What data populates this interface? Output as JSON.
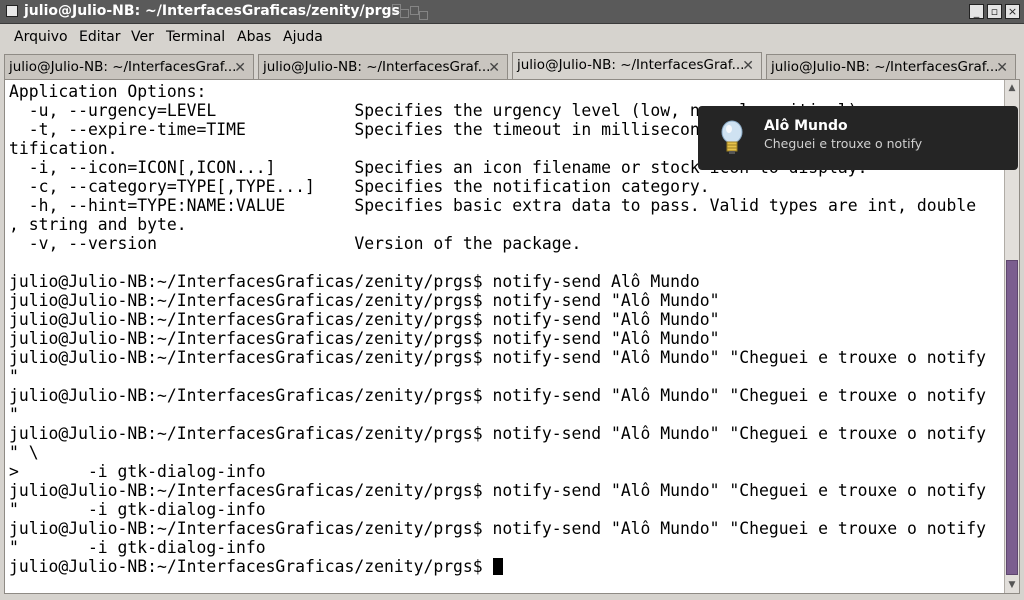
{
  "window": {
    "title": "julio@Julio-NB: ~/InterfacesGraficas/zenity/prgs"
  },
  "menu": [
    "Arquivo",
    "Editar",
    "Ver",
    "Terminal",
    "Abas",
    "Ajuda"
  ],
  "tabs": [
    {
      "label": "julio@Julio-NB: ~/InterfacesGraf...",
      "active": false
    },
    {
      "label": "julio@Julio-NB: ~/InterfacesGraf...",
      "active": false
    },
    {
      "label": "julio@Julio-NB: ~/InterfacesGraf...",
      "active": true
    },
    {
      "label": "julio@Julio-NB: ~/InterfacesGraf...",
      "active": false
    }
  ],
  "terminal": {
    "lines": [
      "Application Options:",
      "  -u, --urgency=LEVEL              Specifies the urgency level (low, normal, critical).",
      "  -t, --expire-time=TIME           Specifies the timeout in milliseconds at which to expire the no",
      "tification.",
      "  -i, --icon=ICON[,ICON...]        Specifies an icon filename or stock icon to display.",
      "  -c, --category=TYPE[,TYPE...]    Specifies the notification category.",
      "  -h, --hint=TYPE:NAME:VALUE       Specifies basic extra data to pass. Valid types are int, double",
      ", string and byte.",
      "  -v, --version                    Version of the package.",
      "",
      "julio@Julio-NB:~/InterfacesGraficas/zenity/prgs$ notify-send Alô Mundo",
      "julio@Julio-NB:~/InterfacesGraficas/zenity/prgs$ notify-send \"Alô Mundo\"",
      "julio@Julio-NB:~/InterfacesGraficas/zenity/prgs$ notify-send \"Alô Mundo\"",
      "julio@Julio-NB:~/InterfacesGraficas/zenity/prgs$ notify-send \"Alô Mundo\"",
      "julio@Julio-NB:~/InterfacesGraficas/zenity/prgs$ notify-send \"Alô Mundo\" \"Cheguei e trouxe o notify",
      "\"",
      "julio@Julio-NB:~/InterfacesGraficas/zenity/prgs$ notify-send \"Alô Mundo\" \"Cheguei e trouxe o notify",
      "\"",
      "julio@Julio-NB:~/InterfacesGraficas/zenity/prgs$ notify-send \"Alô Mundo\" \"Cheguei e trouxe o notify",
      "\" \\",
      ">       -i gtk-dialog-info",
      "julio@Julio-NB:~/InterfacesGraficas/zenity/prgs$ notify-send \"Alô Mundo\" \"Cheguei e trouxe o notify",
      "\"       -i gtk-dialog-info",
      "julio@Julio-NB:~/InterfacesGraficas/zenity/prgs$ notify-send \"Alô Mundo\" \"Cheguei e trouxe o notify",
      "\"       -i gtk-dialog-info"
    ],
    "prompt": "julio@Julio-NB:~/InterfacesGraficas/zenity/prgs$ "
  },
  "notification": {
    "title": "Alô Mundo",
    "body": "Cheguei e trouxe o notify",
    "icon": "lightbulb-icon"
  },
  "colors": {
    "titlebar": "#5a5a5a",
    "scroll_thumb": "#7b5e8f",
    "notification_bg": "#252525"
  }
}
